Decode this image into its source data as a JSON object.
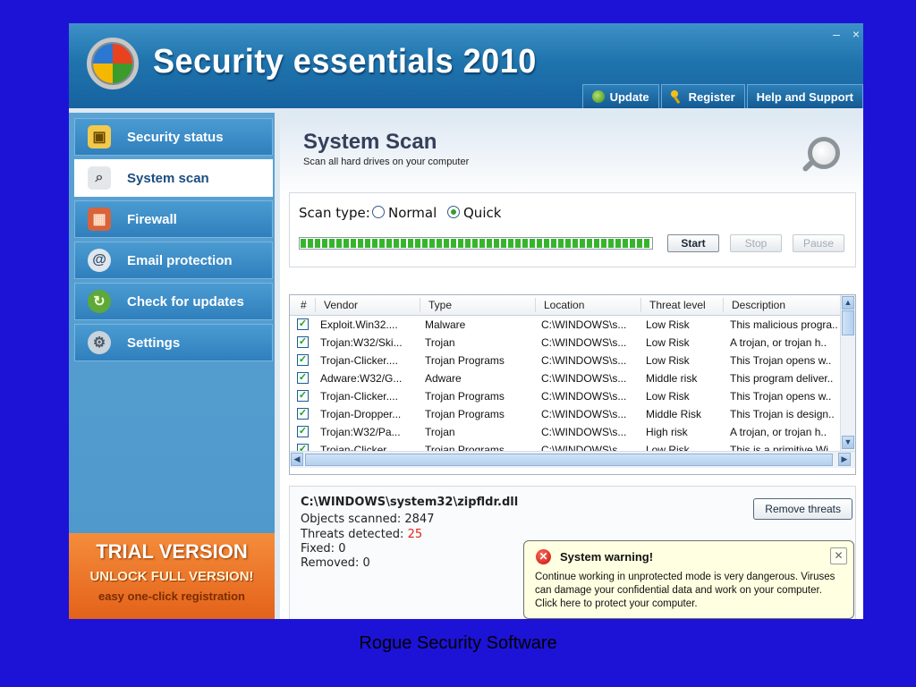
{
  "app": {
    "title": "Security essentials 2010",
    "window_controls": [
      "–",
      "×"
    ]
  },
  "topnav": [
    {
      "label": "Update",
      "icon": "update-icon"
    },
    {
      "label": "Register",
      "icon": "key-icon"
    },
    {
      "label": "Help and Support",
      "icon": ""
    }
  ],
  "sidebar": {
    "items": [
      {
        "label": "Security status",
        "icon": "lock-icon",
        "active": false
      },
      {
        "label": "System scan",
        "icon": "magnifier-icon",
        "active": true
      },
      {
        "label": "Firewall",
        "icon": "firewall-icon",
        "active": false
      },
      {
        "label": "Email protection",
        "icon": "email-icon",
        "active": false
      },
      {
        "label": "Check for updates",
        "icon": "update-icon",
        "active": false
      },
      {
        "label": "Settings",
        "icon": "gear-icon",
        "active": false
      }
    ],
    "trial": {
      "title": "TRIAL VERSION",
      "unlock": "UNLOCK FULL VERSION!",
      "note": "easy one-click registration"
    }
  },
  "main": {
    "title": "System Scan",
    "subtitle": "Scan all hard drives on your computer",
    "scan": {
      "type_label": "Scan type:",
      "options": [
        "Normal",
        "Quick"
      ],
      "selected": "Quick",
      "progress_percent": 100,
      "buttons": {
        "start": "Start",
        "stop": "Stop",
        "pause": "Pause"
      }
    },
    "table": {
      "columns": [
        "#",
        "Vendor",
        "Type",
        "Location",
        "Threat level",
        "Description"
      ],
      "rows": [
        {
          "checked": true,
          "vendor": "Exploit.Win32....",
          "type": "Malware",
          "location": "C:\\WINDOWS\\s...",
          "threat": "Low Risk",
          "description": "This malicious progra.."
        },
        {
          "checked": true,
          "vendor": "Trojan:W32/Ski...",
          "type": "Trojan",
          "location": "C:\\WINDOWS\\s...",
          "threat": "Low Risk",
          "description": "A trojan, or trojan h.."
        },
        {
          "checked": true,
          "vendor": "Trojan-Clicker....",
          "type": "Trojan Programs",
          "location": "C:\\WINDOWS\\s...",
          "threat": "Low Risk",
          "description": "This Trojan opens w.."
        },
        {
          "checked": true,
          "vendor": "Adware:W32/G...",
          "type": "Adware",
          "location": "C:\\WINDOWS\\s...",
          "threat": "Middle risk",
          "description": "This program deliver.."
        },
        {
          "checked": true,
          "vendor": "Trojan-Clicker....",
          "type": "Trojan Programs",
          "location": "C:\\WINDOWS\\s...",
          "threat": "Low Risk",
          "description": "This Trojan opens w.."
        },
        {
          "checked": true,
          "vendor": "Trojan-Dropper...",
          "type": "Trojan Programs",
          "location": "C:\\WINDOWS\\s...",
          "threat": "Middle Risk",
          "description": "This Trojan is design.."
        },
        {
          "checked": true,
          "vendor": "Trojan:W32/Pa...",
          "type": "Trojan",
          "location": "C:\\WINDOWS\\s...",
          "threat": "High risk",
          "description": "A trojan, or trojan h.."
        },
        {
          "checked": true,
          "vendor": "Trojan-Clicker....",
          "type": "Trojan Programs",
          "location": "C:\\WINDOWS\\s...",
          "threat": "Low Risk",
          "description": "This is a primitive Wi.."
        }
      ]
    },
    "details": {
      "path": "C:\\WINDOWS\\system32\\zipfldr.dll",
      "objects_label": "Objects scanned: ",
      "objects_value": "2847",
      "threats_label": "Threats detected: ",
      "threats_value": "25",
      "fixed_label": "Fixed: ",
      "fixed_value": "0",
      "removed_label": "Removed: ",
      "removed_value": "0",
      "remove_button": "Remove threats"
    }
  },
  "warning": {
    "title": "System warning!",
    "body": "Continue working in unprotected mode is very dangerous. Viruses can damage your confidential data and work on your computer. Click here to protect your computer."
  },
  "caption": "Rogue Security Software",
  "colors": {
    "background": "#1d13d6",
    "title_bar": "#1f74ad",
    "trial": "#e3621a",
    "threat_count": "#e0251b"
  }
}
